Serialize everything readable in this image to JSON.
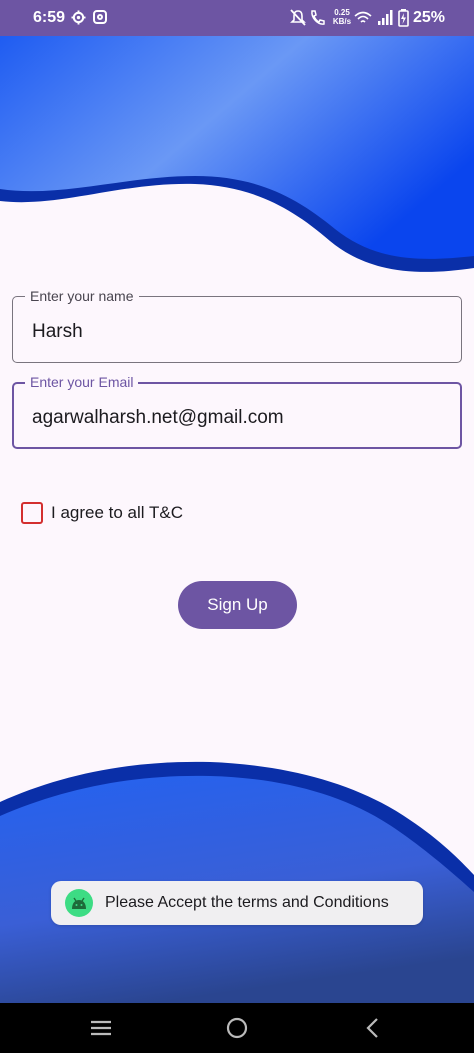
{
  "status_bar": {
    "time": "6:59",
    "network_speed_value": "0.25",
    "network_speed_unit": "KB/s",
    "battery": "25%",
    "icons": [
      "settings-icon",
      "instagram-icon",
      "mute-icon",
      "wifi-call-icon",
      "wifi-icon",
      "signal-icon",
      "battery-icon"
    ]
  },
  "form": {
    "name_label": "Enter your name",
    "name_value": "Harsh",
    "email_label": "Enter your Email",
    "email_value": "agarwalharsh.net@gmail.com",
    "agree_label": "I agree to all T&C",
    "agree_checked": false,
    "signup_label": "Sign Up"
  },
  "toast": {
    "message": "Please Accept the terms and Conditions",
    "icon": "android-icon"
  },
  "nav": {
    "buttons": [
      "recent-apps-icon",
      "home-icon",
      "back-icon"
    ]
  },
  "colors": {
    "primary": "#6d55a3",
    "wave_blue": "#1a5cf0",
    "wave_dark": "#0a2fa8",
    "checkbox_border": "#d32f2f",
    "background": "#fdf7fd"
  }
}
